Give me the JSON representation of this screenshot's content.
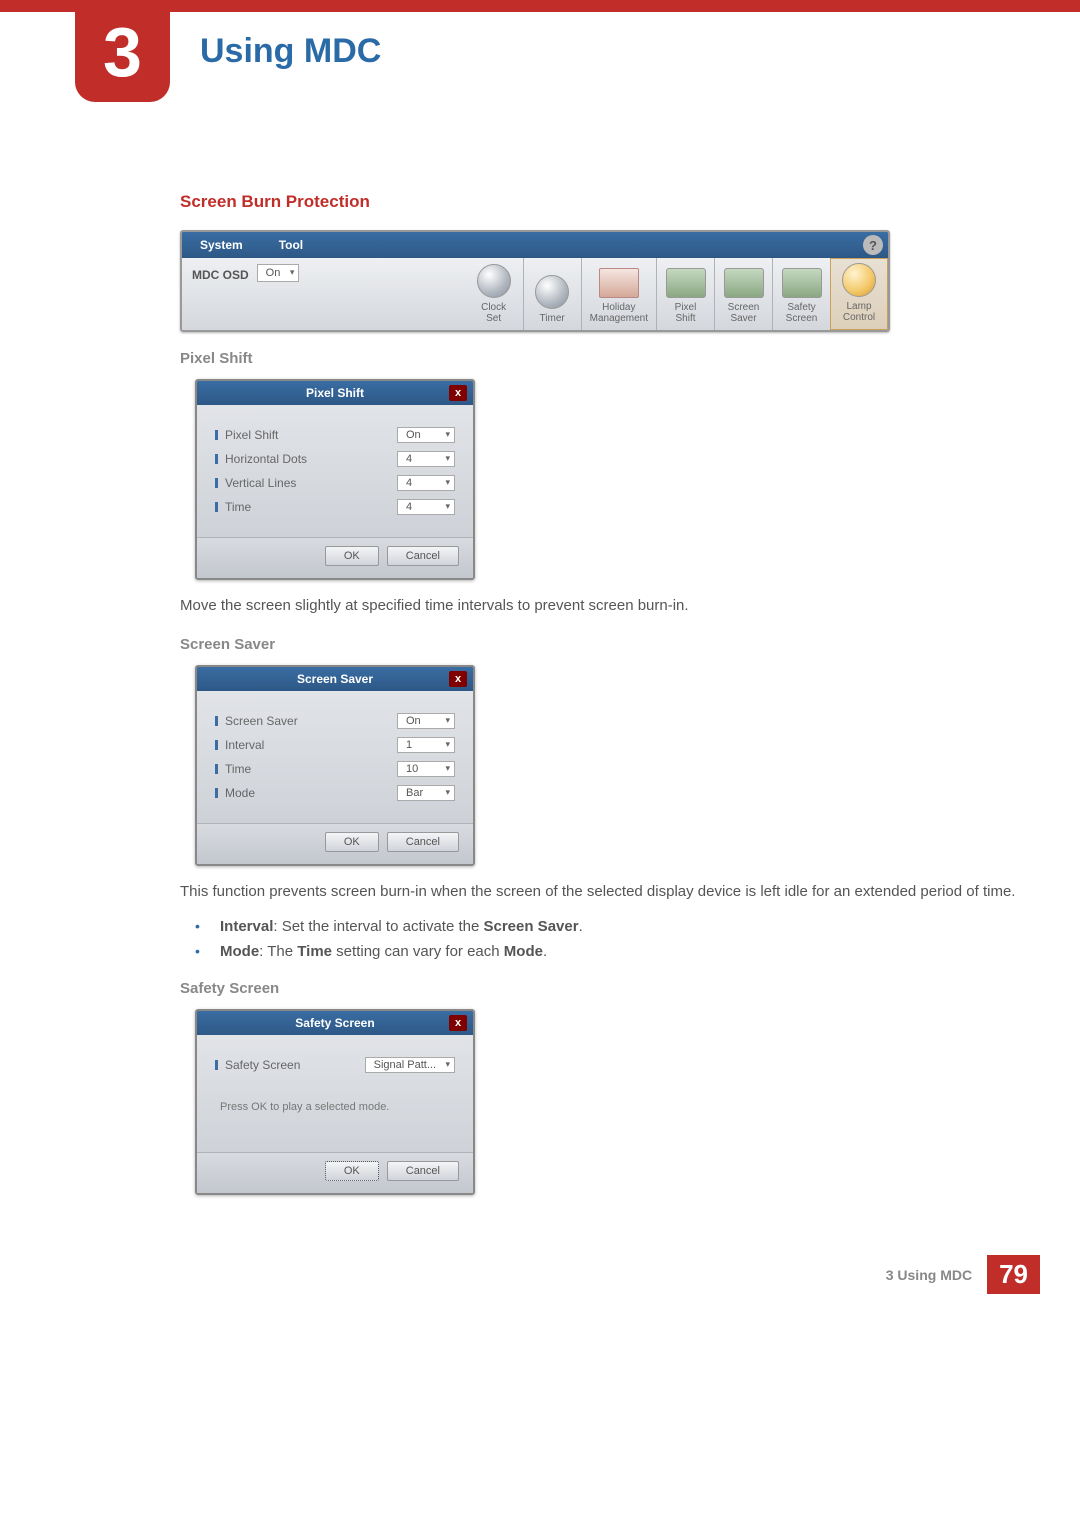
{
  "chapter": {
    "number": "3",
    "title": "Using MDC"
  },
  "section_heading": "Screen Burn Protection",
  "toolbar": {
    "menu": {
      "system": "System",
      "tool": "Tool"
    },
    "mdc_osd_label": "MDC OSD",
    "mdc_osd_value": "On",
    "items": [
      {
        "label1": "Clock",
        "label2": "Set"
      },
      {
        "label1": "Timer",
        "label2": ""
      },
      {
        "label1": "Holiday",
        "label2": "Management"
      },
      {
        "label1": "Pixel",
        "label2": "Shift"
      },
      {
        "label1": "Screen",
        "label2": "Saver"
      },
      {
        "label1": "Safety",
        "label2": "Screen"
      },
      {
        "label1": "Lamp",
        "label2": "Control"
      }
    ]
  },
  "pixel_shift": {
    "heading": "Pixel Shift",
    "title": "Pixel Shift",
    "rows": [
      {
        "label": "Pixel Shift",
        "value": "On"
      },
      {
        "label": "Horizontal Dots",
        "value": "4"
      },
      {
        "label": "Vertical Lines",
        "value": "4"
      },
      {
        "label": "Time",
        "value": "4"
      }
    ],
    "ok": "OK",
    "cancel": "Cancel",
    "desc": "Move the screen slightly at specified time intervals to prevent screen burn-in."
  },
  "screen_saver": {
    "heading": "Screen Saver",
    "title": "Screen Saver",
    "rows": [
      {
        "label": "Screen Saver",
        "value": "On"
      },
      {
        "label": "Interval",
        "value": "1"
      },
      {
        "label": "Time",
        "value": "10"
      },
      {
        "label": "Mode",
        "value": "Bar"
      }
    ],
    "ok": "OK",
    "cancel": "Cancel",
    "desc": "This function prevents screen burn-in when the screen of the selected display device is left idle for an extended period of time.",
    "bullets": {
      "interval_bold": "Interval",
      "interval_rest": ": Set the interval to activate the ",
      "interval_bold2": "Screen Saver",
      "interval_end": ".",
      "mode_bold": "Mode",
      "mode_mid1": ": The ",
      "mode_bold2": "Time",
      "mode_mid2": " setting can vary for each ",
      "mode_bold3": "Mode",
      "mode_end": "."
    }
  },
  "safety_screen": {
    "heading": "Safety Screen",
    "title": "Safety Screen",
    "row_label": "Safety Screen",
    "row_value": "Signal Patt...",
    "msg": "Press OK to play a selected mode.",
    "ok": "OK",
    "cancel": "Cancel"
  },
  "footer": {
    "text": "3 Using MDC",
    "page": "79"
  }
}
